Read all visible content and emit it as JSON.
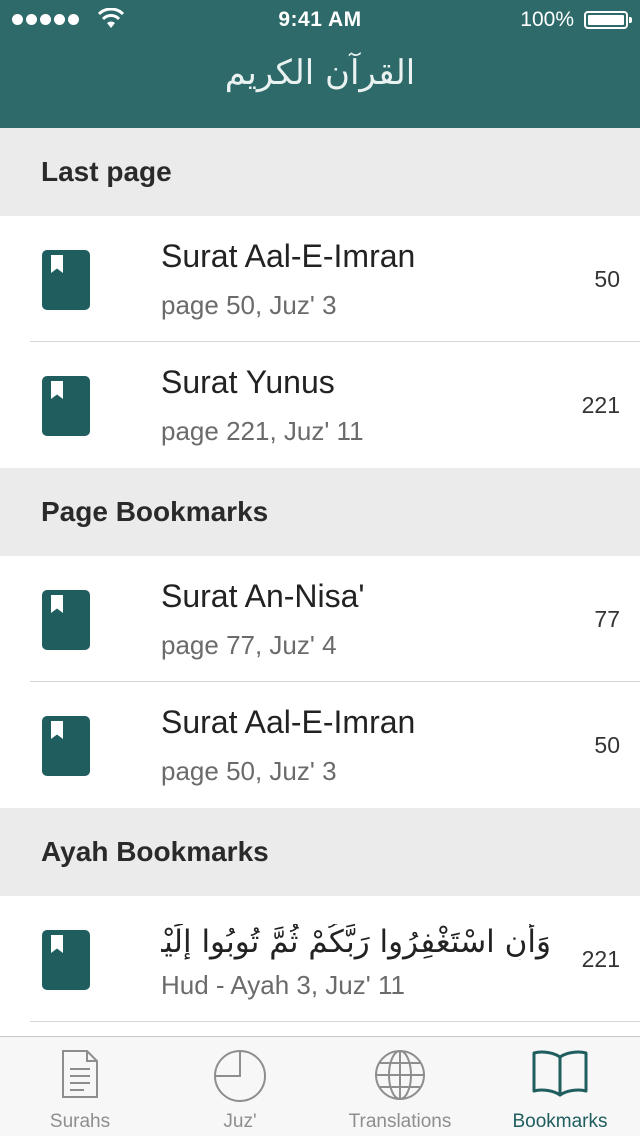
{
  "status_bar": {
    "time": "9:41 AM",
    "battery": "100%",
    "signal_icon": "signal-dots-icon",
    "wifi_icon": "wifi-icon"
  },
  "header": {
    "title": "القرآن الكريم"
  },
  "colors": {
    "header": "#2e6a6a",
    "accent": "#1f5d5e",
    "section_bg": "#ebebeb"
  },
  "sections": {
    "last_page": {
      "title": "Last page",
      "rows": [
        {
          "title": "Surat Aal-E-Imran",
          "subtitle": "page 50, Juz' 3",
          "number": "50"
        },
        {
          "title": "Surat Yunus",
          "subtitle": "page 221, Juz' 11",
          "number": "221"
        }
      ]
    },
    "page_bookmarks": {
      "title": "Page Bookmarks",
      "rows": [
        {
          "title": "Surat An-Nisa'",
          "subtitle": "page 77, Juz' 4",
          "number": "77"
        },
        {
          "title": "Surat Aal-E-Imran",
          "subtitle": "page 50, Juz' 3",
          "number": "50"
        }
      ]
    },
    "ayah_bookmarks": {
      "title": "Ayah Bookmarks",
      "rows": [
        {
          "text": "وَأَنِ اسْتَغْفِرُوا رَبَّكُمْ ثُمَّ تُوبُوا إِلَيْهِ...",
          "subtitle": "Hud - Ayah 3, Juz' 11",
          "number": "221"
        }
      ]
    }
  },
  "tabs": [
    {
      "label": "Surahs",
      "icon": "document-icon",
      "active": false
    },
    {
      "label": "Juz'",
      "icon": "pie-icon",
      "active": false
    },
    {
      "label": "Translations",
      "icon": "globe-icon",
      "active": false
    },
    {
      "label": "Bookmarks",
      "icon": "open-book-icon",
      "active": true
    }
  ]
}
